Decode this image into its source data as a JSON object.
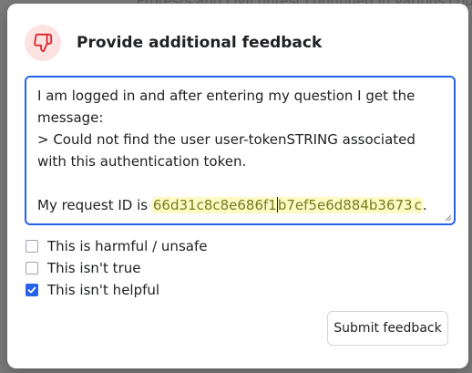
{
  "background": {
    "text": "Protests and civil unrest continued in various coun"
  },
  "modal": {
    "icon": "thumbs-down-icon",
    "title": "Provide additional feedback",
    "textarea": {
      "line1": "I am logged in and after entering my question I get the message:",
      "line2": "> Could not find the user user-tokenSTRING associated with this authentication token.",
      "request_prefix": "My request ID is ",
      "request_id_part1": "66d31c8c8e686f1",
      "request_id_part2": "b7ef5e6d884b3673",
      "request_id_tail": "c",
      "request_suffix": "."
    },
    "options": [
      {
        "label": "This is harmful / unsafe",
        "checked": false
      },
      {
        "label": "This isn't true",
        "checked": false
      },
      {
        "label": "This isn't helpful",
        "checked": true
      }
    ],
    "submit_label": "Submit feedback"
  },
  "colors": {
    "accent": "#2563eb",
    "icon_bg": "#fde2e2",
    "icon_stroke": "#dc2626",
    "highlight": "#fdfbc3"
  }
}
